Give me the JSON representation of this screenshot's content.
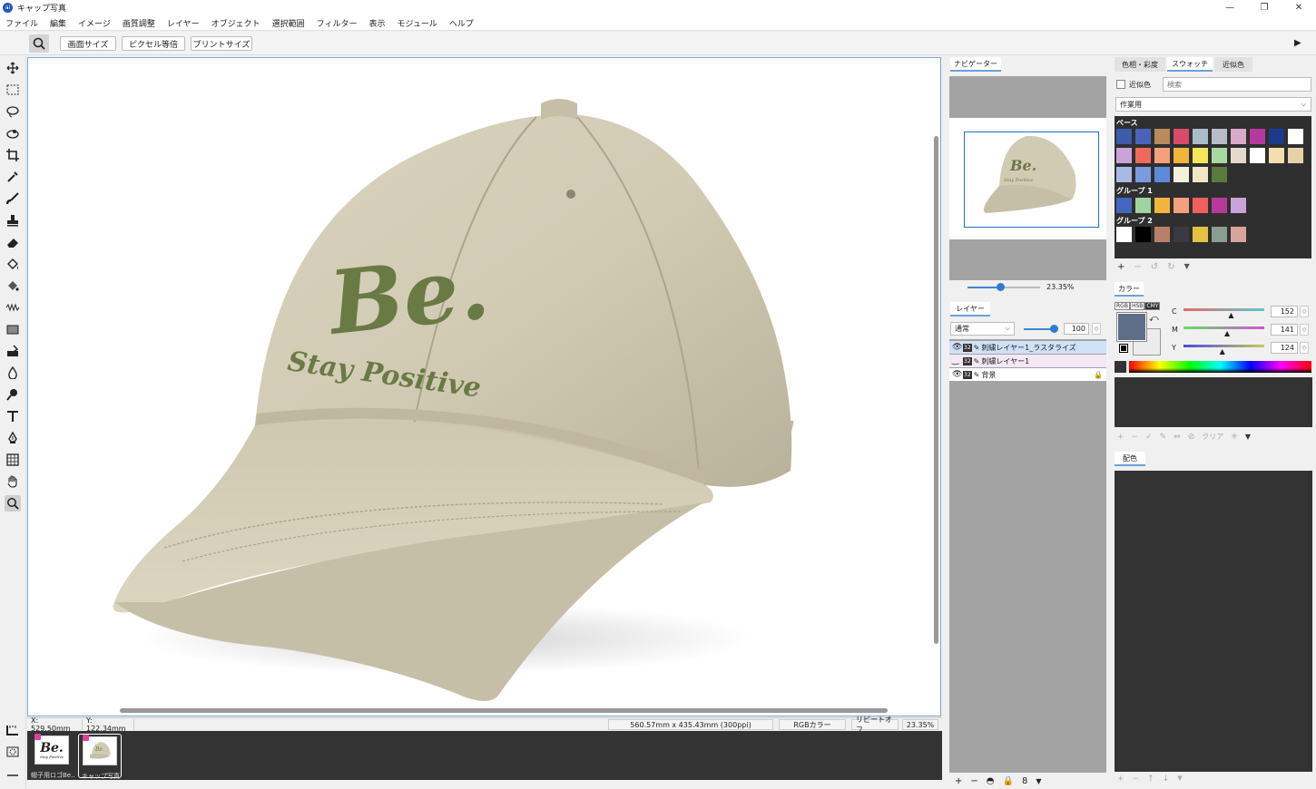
{
  "window": {
    "title": "キャップ写真",
    "app_icon": "ai"
  },
  "menu": [
    "ファイル",
    "編集",
    "イメージ",
    "画質調整",
    "レイヤー",
    "オブジェクト",
    "選択範囲",
    "フィルター",
    "表示",
    "モジュール",
    "ヘルプ"
  ],
  "toolbar": {
    "buttons": [
      "画面サイズ",
      "ピクセル等倍",
      "プリントサイズ"
    ]
  },
  "canvas": {
    "logo_main": "Be.",
    "logo_sub": "Stay Positive"
  },
  "status": {
    "x": "X: 529.50mm",
    "y": "Y: 122.34mm",
    "size": "560.57mm x 435.43mm (300ppi)",
    "color_mode": "RGBカラー",
    "repeat": "リピートオフ",
    "zoom": "23.35%"
  },
  "filmstrip": [
    {
      "label": "帽子用ロゴBe...",
      "logo_main": "Be.",
      "logo_sub": "Stay Positive",
      "selected": false
    },
    {
      "label": "キャップ写真",
      "logo_main": "Be.",
      "logo_sub": "",
      "selected": true
    }
  ],
  "navigator": {
    "tab": "ナビゲーター",
    "zoom": "23.35%",
    "zoom_fraction": 0.45
  },
  "layers": {
    "tab": "レイヤー",
    "blend_mode": "通常",
    "opacity": "100",
    "items": [
      {
        "name": "刺繍レイヤー1_ラスタライズ",
        "bits": "32",
        "selected": true,
        "locked": false
      },
      {
        "name": "刺繍レイヤー1",
        "bits": "32",
        "selected": false,
        "locked": false
      },
      {
        "name": "背景",
        "bits": "32",
        "selected": false,
        "locked": true
      }
    ]
  },
  "swatches_panel": {
    "tabs": [
      "色相・彩度",
      "スウォッチ",
      "近似色"
    ],
    "similar_label": "近似色",
    "search_placeholder": "検索",
    "set": "作業用",
    "groups": [
      {
        "name": "ベース",
        "colors": [
          "#3d5aab",
          "#4a63b8",
          "#b88a5c",
          "#d94b6a",
          "#a9bcc8",
          "#b9bcc6",
          "#d9a9c9",
          "#b7399b",
          "#1e3a8a",
          "#ffffff",
          "#c9a3d9",
          "#f06a5a",
          "#f5a07c",
          "#f0b53a",
          "#f5e55a",
          "#a9d9a0",
          "#e6d9cc",
          "#ffffff",
          "#f2dfb0",
          "#e6d2a6",
          "#a9b9e6",
          "#7b9be0",
          "#5d8ad9",
          "#f5f0dc",
          "#f2e6c9",
          "#5a7a3c"
        ]
      },
      {
        "name": "グループ 1",
        "colors": [
          "#4466c0",
          "#9fd39f",
          "#f0b53a",
          "#f5a07c",
          "#f0605a",
          "#b73a9b",
          "#c9a3d9"
        ]
      },
      {
        "name": "グループ 2",
        "colors": [
          "#ffffff",
          "#000000",
          "#b8806a",
          "#3a3a44",
          "#e6c040",
          "#8a9e90",
          "#d9a49a"
        ]
      }
    ]
  },
  "color_panel": {
    "tab": "カラー",
    "modes": [
      "RGB",
      "HSB",
      "CMY"
    ],
    "current": "#5f6e88",
    "background": "#ececec",
    "channels": [
      {
        "label": "C",
        "value": "152",
        "fraction": 0.6
      },
      {
        "label": "M",
        "value": "141",
        "fraction": 0.55
      },
      {
        "label": "Y",
        "value": "124",
        "fraction": 0.49
      }
    ],
    "clear_label": "クリア"
  },
  "scheme_panel": {
    "tab": "配色"
  }
}
